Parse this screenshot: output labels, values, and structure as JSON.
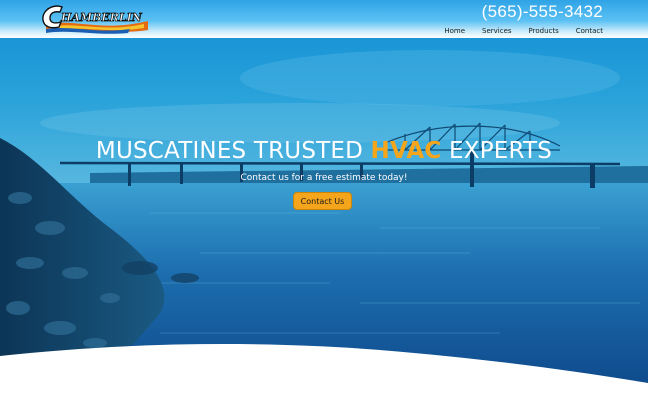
{
  "header": {
    "logo_text": "CHAMBERLIN",
    "phone": "(565)-555-3432",
    "nav": {
      "home": "Home",
      "services": "Services",
      "products": "Products",
      "contact": "Contact"
    }
  },
  "hero": {
    "title_before": "MUSCATINES TRUSTED ",
    "title_accent": "HVAC",
    "title_after": " EXPERTS",
    "subtitle": "Contact us for a free estimate today!",
    "cta_label": "Contact Us"
  },
  "colors": {
    "accent": "#f5a51b",
    "header_blue": "#2fa3e6",
    "hero_blue": "#1e90cf"
  }
}
